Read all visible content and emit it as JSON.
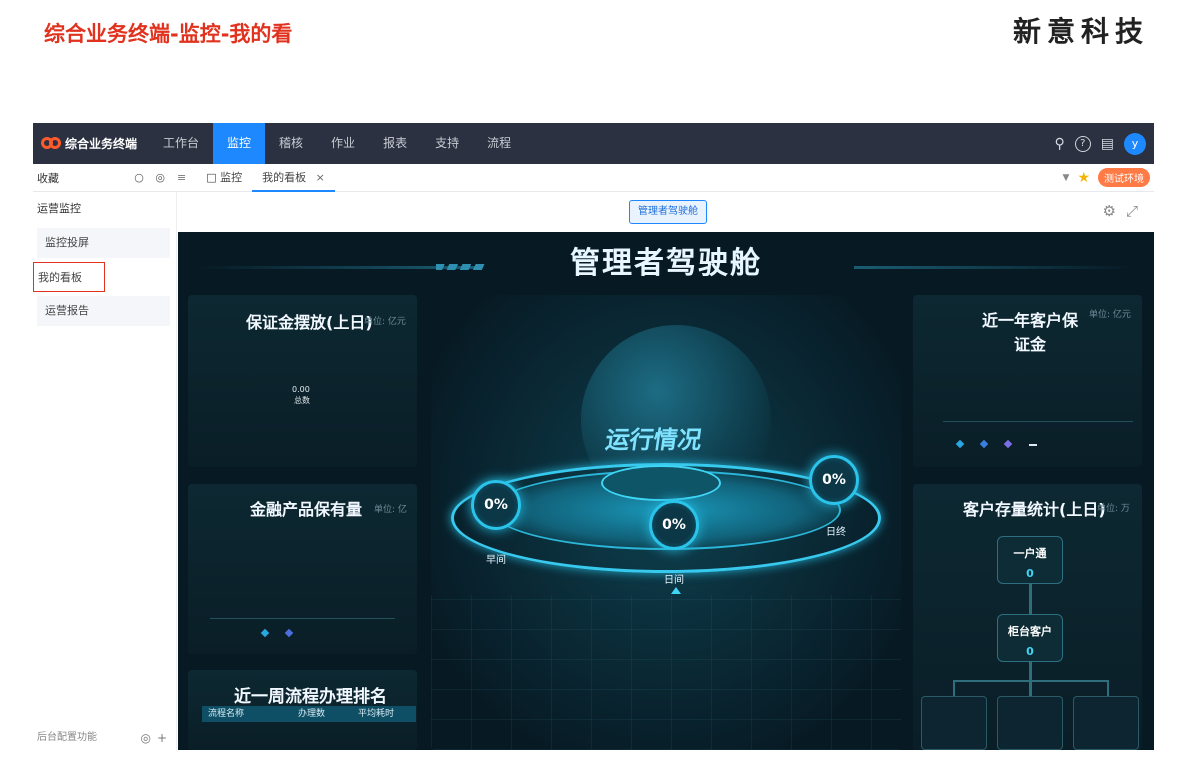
{
  "slide": {
    "title": "综合业务终端-监控-我的看",
    "brand": "新意科技"
  },
  "app": {
    "logo_text": "综合业务终端",
    "nav": [
      "工作台",
      "监控",
      "稽核",
      "作业",
      "报表",
      "支持",
      "流程"
    ],
    "nav_active_index": 1,
    "avatar_letter": "y",
    "favorites_label": "收藏",
    "tabs": [
      {
        "label": "监控",
        "active": false
      },
      {
        "label": "我的看板",
        "active": true
      }
    ],
    "tab_close_glyph": "×",
    "env_badge": "测试环境",
    "sidebar": {
      "group": "运营监控",
      "items": [
        "监控投屏",
        "我的看板",
        "运营报告"
      ],
      "selected_index": 1,
      "footer": "后台配置功能"
    },
    "manager_button": "管理者驾驶舱",
    "icons": [
      "search-icon",
      "help-icon",
      "notification-icon",
      "settings-icon",
      "fullscreen-icon",
      "star-icon"
    ],
    "accent_color": "#1e88ff",
    "brand_color": "#e0321e"
  },
  "dashboard": {
    "title": "管理者驾驶舱",
    "panels": {
      "deposit": {
        "title": "保证金摆放(上日)",
        "unit": "单位: 亿元",
        "value": "0.00",
        "value_label": "总数"
      },
      "customer_deposit": {
        "title": "近一年客户保证金",
        "unit": "单位: 亿元",
        "legend": [
          "",
          "",
          "",
          ""
        ]
      },
      "financial": {
        "title": "金融产品保有量",
        "unit": "单位: 亿",
        "legend": [
          "",
          ""
        ]
      },
      "customer_stock": {
        "title": "客户存量统计(上日)",
        "unit": "单位: 万",
        "nodes": [
          {
            "label": "一户通",
            "value": "0"
          },
          {
            "label": "柜台客户",
            "value": "0"
          }
        ]
      },
      "weekly": {
        "title": "近一周流程办理排名",
        "columns": [
          "流程名称",
          "办理数",
          "平均耗时"
        ]
      }
    },
    "center": {
      "label": "运行情况",
      "gauges": [
        {
          "value": "0%",
          "label": "早间"
        },
        {
          "value": "0%",
          "label": "日间"
        },
        {
          "value": "0%",
          "label": "日终"
        }
      ]
    }
  }
}
